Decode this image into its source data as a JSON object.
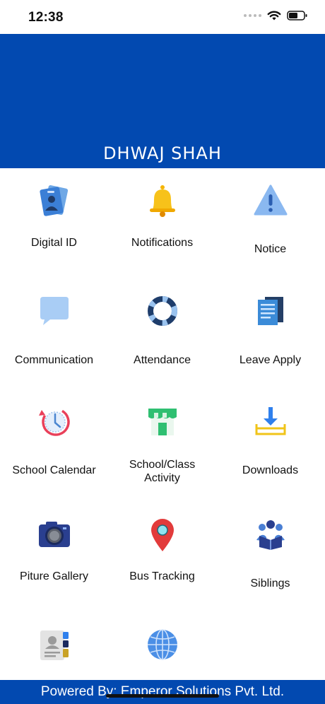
{
  "status_bar": {
    "time": "12:38"
  },
  "header": {
    "user_name": "DHWAJ SHAH",
    "color": "#0249b0"
  },
  "menu": [
    {
      "label": "Digital ID",
      "icon": "id-card-icon"
    },
    {
      "label": "Notifications",
      "icon": "bell-icon"
    },
    {
      "label": "Notice",
      "icon": "warning-icon"
    },
    {
      "label": "Communication",
      "icon": "chat-bubble-icon"
    },
    {
      "label": "Attendance",
      "icon": "ring-icon"
    },
    {
      "label": "Leave Apply",
      "icon": "documents-icon"
    },
    {
      "label": "School Calendar",
      "icon": "clock-history-icon"
    },
    {
      "label": "School/Class Activity",
      "label_line1": "School/Class",
      "label_line2": "Activity",
      "icon": "store-icon"
    },
    {
      "label": "Downloads",
      "icon": "download-tray-icon"
    },
    {
      "label": "Piture Gallery",
      "icon": "camera-icon"
    },
    {
      "label": "Bus Tracking",
      "icon": "map-pin-icon"
    },
    {
      "label": "Siblings",
      "icon": "group-reading-icon"
    },
    {
      "label": "",
      "icon": "contact-book-icon"
    },
    {
      "label": "",
      "icon": "globe-icon"
    }
  ],
  "footer": {
    "text": "Powered By: Emperor Solutions Pvt. Ltd."
  }
}
